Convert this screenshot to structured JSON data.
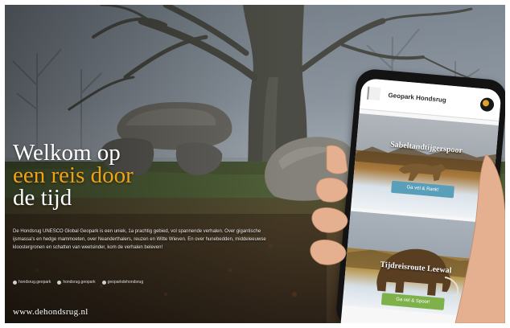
{
  "headline": {
    "line1": "Welkom op",
    "line2": "een reis door",
    "line3": "de tijd"
  },
  "intro_text": "De Hondsrug UNESCO Global Geopark is een uniek, 1a prachtig gebied, vol spannende verhalen. Over gigantische ijsmassa's en hedge mammoeten, over Neanderthalers, reuzen en Witte Wieven. En over hunebedden, middeleeuwse kloostergronen en schatten van weetsinder, kom de verhalen beleven!",
  "social": [
    {
      "icon": "camera-icon",
      "label": "hondsrug.geopark"
    },
    {
      "icon": "facebook-icon",
      "label": "hondsrug.geopark"
    },
    {
      "icon": "globe-icon",
      "label": "geoparkdehondsrug"
    }
  ],
  "website_url": "www.dehondsrug.nl",
  "colors": {
    "accent": "#f2a115",
    "button_blue": "#5a9fb9",
    "button_green": "#7fb14b"
  },
  "phone": {
    "app_title": "Geopark Hondsrug",
    "cards": [
      {
        "title": "Sabeltandtijgerspoor",
        "button_label": "Ga vel & Rank!"
      },
      {
        "title": "Tijdreisroute Leewal",
        "button_label": "Ga vel & Spoor!"
      }
    ]
  }
}
